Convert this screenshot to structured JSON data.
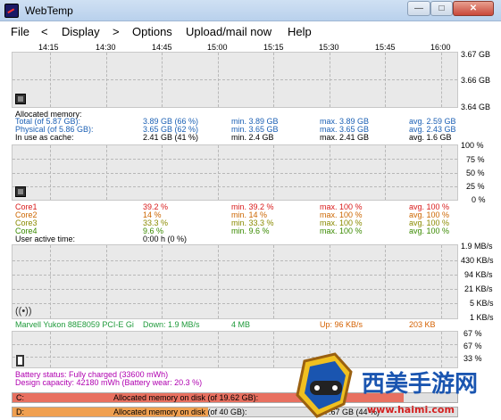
{
  "window": {
    "title": "WebTemp",
    "btn_min": "—",
    "btn_max": "□",
    "btn_close": "✕"
  },
  "menu": [
    "File",
    "<",
    "Display",
    ">",
    "Options",
    "Upload/mail now",
    "Help"
  ],
  "times": [
    "14:15",
    "14:30",
    "14:45",
    "15:00",
    "15:15",
    "15:30",
    "15:45",
    "16:00"
  ],
  "memory_axis": [
    "3.67 GB",
    "3.66 GB",
    "3.64 GB"
  ],
  "memory": {
    "heading": "Allocated memory:",
    "rows": [
      {
        "label": "Total (of 5.87 GB):",
        "cur": "3.89 GB (66 %)",
        "min": "min. 3.89 GB",
        "max": "max. 3.89 GB",
        "avg": "avg. 2.59 GB"
      },
      {
        "label": "Physical (of 5.86 GB):",
        "cur": "3.65 GB (62 %)",
        "min": "min. 3.65 GB",
        "max": "max. 3.65 GB",
        "avg": "avg. 2.43 GB"
      },
      {
        "label": "In use as cache:",
        "cur": "2.41 GB (41 %)",
        "min": "min. 2.4 GB",
        "max": "max. 2.41 GB",
        "avg": "avg. 1.6 GB"
      }
    ]
  },
  "cpu_axis": [
    "100 %",
    "75 %",
    "50 %",
    "25 %",
    "0 %"
  ],
  "cpu": {
    "rows": [
      {
        "label": "Core1",
        "cur": "39.2 %",
        "min": "min. 39.2 %",
        "max": "max. 100 %",
        "avg": "avg. 100 %"
      },
      {
        "label": "Core2",
        "cur": "14 %",
        "min": "min. 14 %",
        "max": "max. 100 %",
        "avg": "avg. 100 %"
      },
      {
        "label": "Core3",
        "cur": "33.3 %",
        "min": "min. 33.3 %",
        "max": "max. 100 %",
        "avg": "avg. 100 %"
      },
      {
        "label": "Core4",
        "cur": "9.6 %",
        "min": "min. 9.6 %",
        "max": "max. 100 %",
        "avg": "avg. 100 %"
      }
    ],
    "active_label": "User active time:",
    "active_value": "0:00 h (0 %)"
  },
  "net_axis": [
    "1.9 MB/s",
    "430 KB/s",
    "94 KB/s",
    "21 KB/s",
    "5 KB/s",
    "1 KB/s"
  ],
  "net": {
    "adapter": "Marvell Yukon 88E8059 PCI-E Gi",
    "down": "Down: 1.9 MB/s",
    "down_total": "4 MB",
    "up": "Up: 96 KB/s",
    "up_total": "203 KB"
  },
  "bat_axis": [
    "67 %",
    "67 %",
    "33 %"
  ],
  "battery": {
    "status": "Battery status: Fully charged (33600 mWh)",
    "design": "Design capacity: 42180 mWh (Battery wear: 20.3 %)"
  },
  "disks": [
    {
      "drive": "C:",
      "text": "Allocated memory on disk (of 19.62 GB):",
      "fill": 0.88,
      "color": "#e87060"
    },
    {
      "drive": "D:",
      "text": "Allocated memory on disk (of 40 GB):",
      "extra": "17.67 GB (44 %)",
      "fill": 0.44,
      "color": "#f0a050"
    }
  ],
  "logo": {
    "text": "西美手游网",
    "url": "www.haimi.com"
  },
  "colors": {
    "plot_bg": "#e9e9e9",
    "memory": "#1a5fb4",
    "cpu": "#d91a1a",
    "net": "#1e9a3a",
    "battery": "#b000b0"
  }
}
